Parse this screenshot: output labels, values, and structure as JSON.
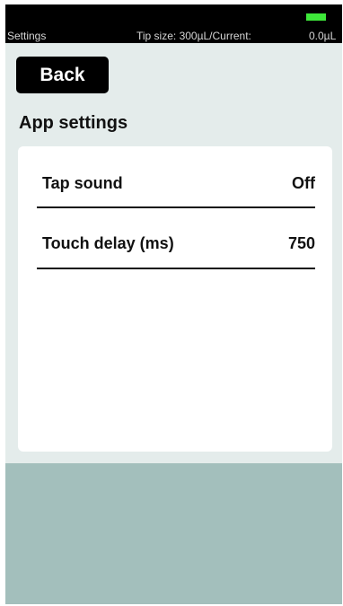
{
  "status_bar": {
    "title": "Settings",
    "tip_size": "Tip size:  300µL/Current:",
    "current_value": "0.0µL",
    "battery_color": "#3ee83a"
  },
  "header": {
    "back_label": "Back"
  },
  "section": {
    "title": "App settings"
  },
  "settings": [
    {
      "label": "Tap sound",
      "value": "Off"
    },
    {
      "label": "Touch delay (ms)",
      "value": "750"
    }
  ],
  "colors": {
    "background_top": "#e4eceb",
    "background_bottom": "#a3bfbc",
    "status_bar": "#000000",
    "button": "#000000"
  }
}
